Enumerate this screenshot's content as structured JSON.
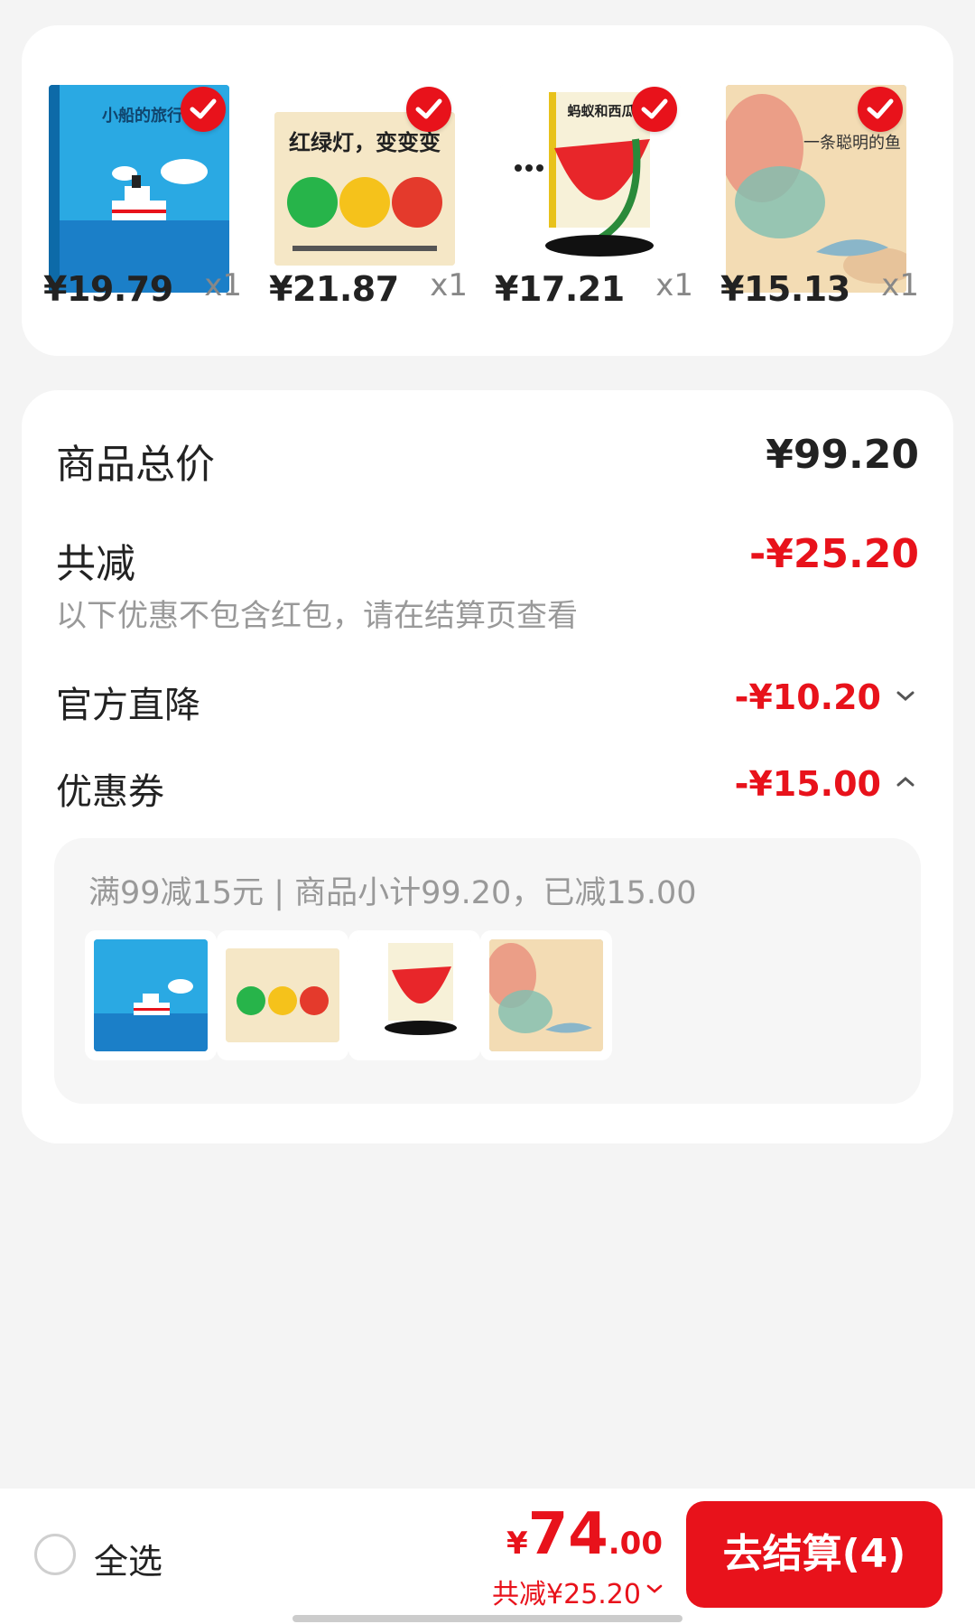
{
  "products": [
    {
      "price": "¥19.79",
      "qty": "x1",
      "cover": "小船的旅行",
      "icon": "book-cover-boat"
    },
    {
      "price": "¥21.87",
      "qty": "x1",
      "cover": "红绿灯，变变变",
      "icon": "book-cover-traffic-light"
    },
    {
      "price": "¥17.21",
      "qty": "x1",
      "cover": "蚂蚁和西瓜",
      "icon": "book-cover-ants-watermelon"
    },
    {
      "price": "¥15.13",
      "qty": "x1",
      "cover": "一条聪明的鱼",
      "icon": "book-cover-fish"
    }
  ],
  "summary": {
    "total_label": "商品总价",
    "total_value": "¥99.20",
    "discount_label": "共减",
    "discount_value": "-¥25.20",
    "hint": "以下优惠不包含红包，请在结算页查看",
    "official_label": "官方直降",
    "official_value": "-¥10.20",
    "coupon_label": "优惠券",
    "coupon_value": "-¥15.00",
    "coupon_desc": "满99减15元 | 商品小计99.20，已减15.00"
  },
  "bottom": {
    "select_all": "全选",
    "currency": "¥",
    "total_int": "74",
    "total_dec": ".00",
    "savings": "共减¥25.20",
    "checkout": "去结算(4)"
  },
  "colors": {
    "accent": "#e8121b",
    "background": "#f4f4f4",
    "card": "#ffffff"
  }
}
